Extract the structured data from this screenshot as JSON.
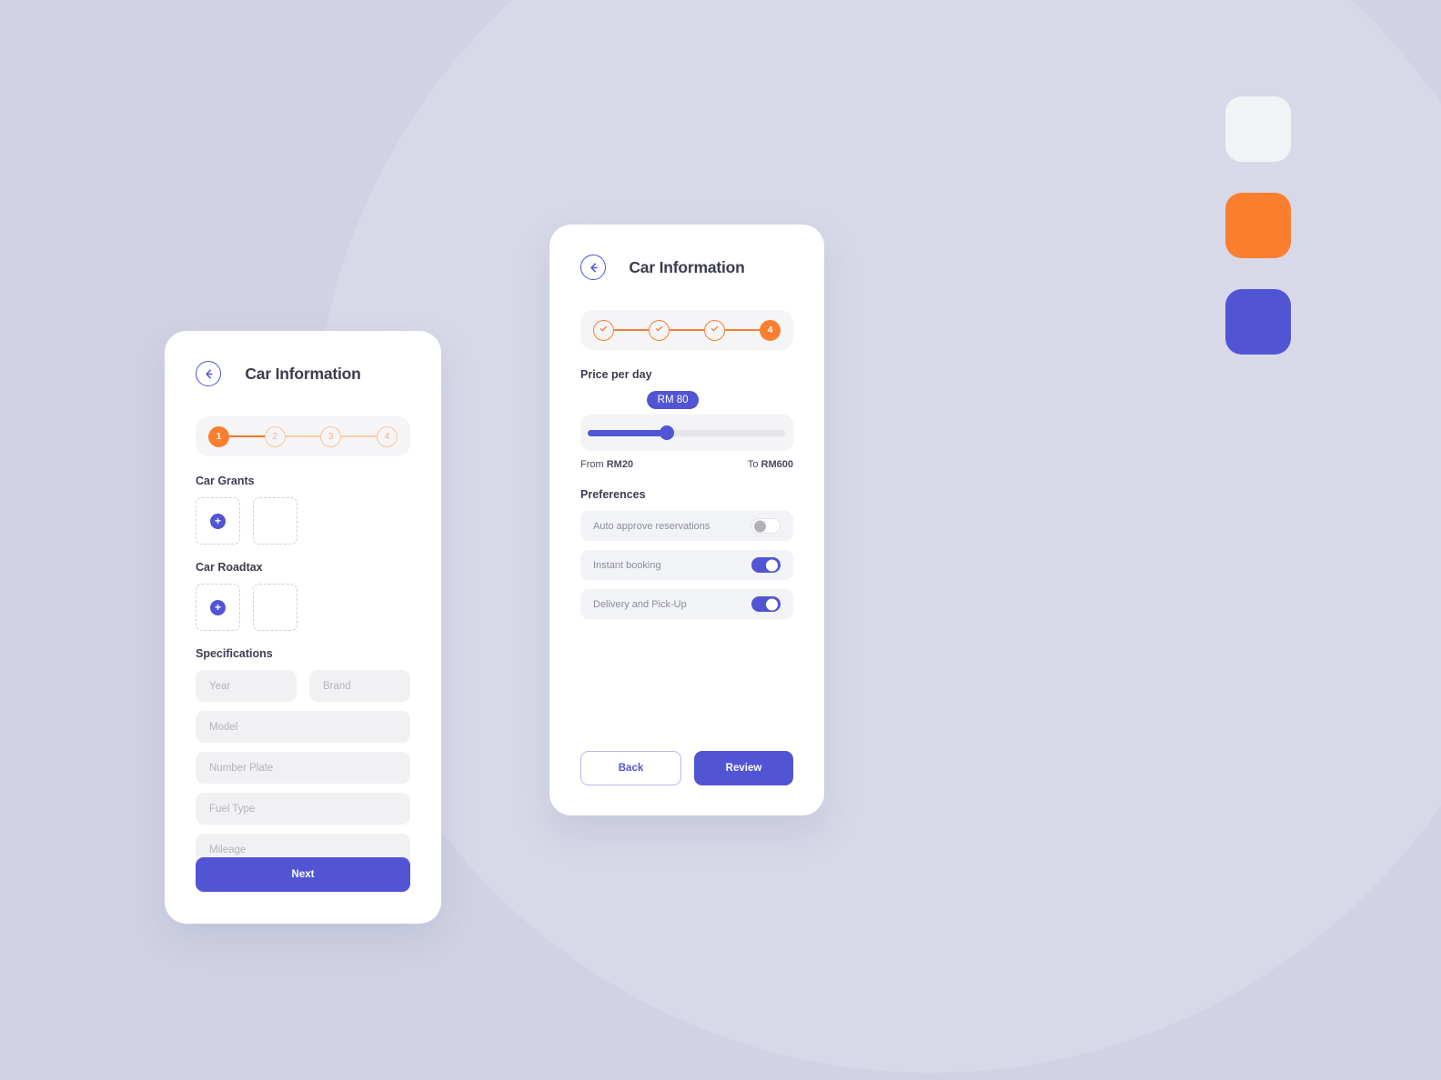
{
  "theme": {
    "background": "#d1d3e4",
    "accent_purple": "#5155d4",
    "accent_orange": "#fc7e2f",
    "surface_light": "#f2f3f5"
  },
  "swatches": [
    {
      "name": "swatch-light",
      "color": "#f2f3f5"
    },
    {
      "name": "swatch-orange",
      "color": "#fc7e2f"
    },
    {
      "name": "swatch-purple",
      "color": "#5155d4"
    }
  ],
  "screen_one": {
    "title": "Car Information",
    "back_icon": "arrow-left-circle-icon",
    "stepper": {
      "steps": [
        {
          "label": "1",
          "state": "active"
        },
        {
          "label": "2",
          "state": "todo"
        },
        {
          "label": "3",
          "state": "todo"
        },
        {
          "label": "4",
          "state": "todo"
        }
      ]
    },
    "car_grants": {
      "label": "Car Grants",
      "add_icon": "plus-icon"
    },
    "car_roadtax": {
      "label": "Car Roadtax",
      "add_icon": "plus-icon"
    },
    "specifications": {
      "label": "Specifications",
      "fields": [
        {
          "name": "year",
          "placeholder": "Year",
          "value": ""
        },
        {
          "name": "brand",
          "placeholder": "Brand",
          "value": ""
        },
        {
          "name": "model",
          "placeholder": "Model",
          "value": ""
        },
        {
          "name": "number-plate",
          "placeholder": "Number Plate",
          "value": ""
        },
        {
          "name": "fuel-type",
          "placeholder": "Fuel Type",
          "value": ""
        },
        {
          "name": "mileage",
          "placeholder": "Mileage",
          "value": ""
        }
      ]
    },
    "next_label": "Next"
  },
  "screen_two": {
    "title": "Car Information",
    "back_icon": "arrow-left-circle-icon",
    "stepper": {
      "steps": [
        {
          "label": "",
          "state": "done"
        },
        {
          "label": "",
          "state": "done"
        },
        {
          "label": "",
          "state": "done"
        },
        {
          "label": "4",
          "state": "active"
        }
      ]
    },
    "price": {
      "label": "Price per day",
      "current_value": "RM 80",
      "current_number": 80,
      "min_label": "From",
      "min_value": "RM20",
      "min_number": 20,
      "max_label": "To",
      "max_value": "RM600",
      "max_number": 600,
      "fill_percent": 40
    },
    "preferences": {
      "label": "Preferences",
      "items": [
        {
          "name": "auto-approve-reservations",
          "label": "Auto approve reservations",
          "enabled": false
        },
        {
          "name": "instant-booking",
          "label": "Instant booking",
          "enabled": true
        },
        {
          "name": "delivery-and-pickup",
          "label": "Delivery and Pick-Up",
          "enabled": true
        }
      ]
    },
    "back_label": "Back",
    "review_label": "Review"
  }
}
